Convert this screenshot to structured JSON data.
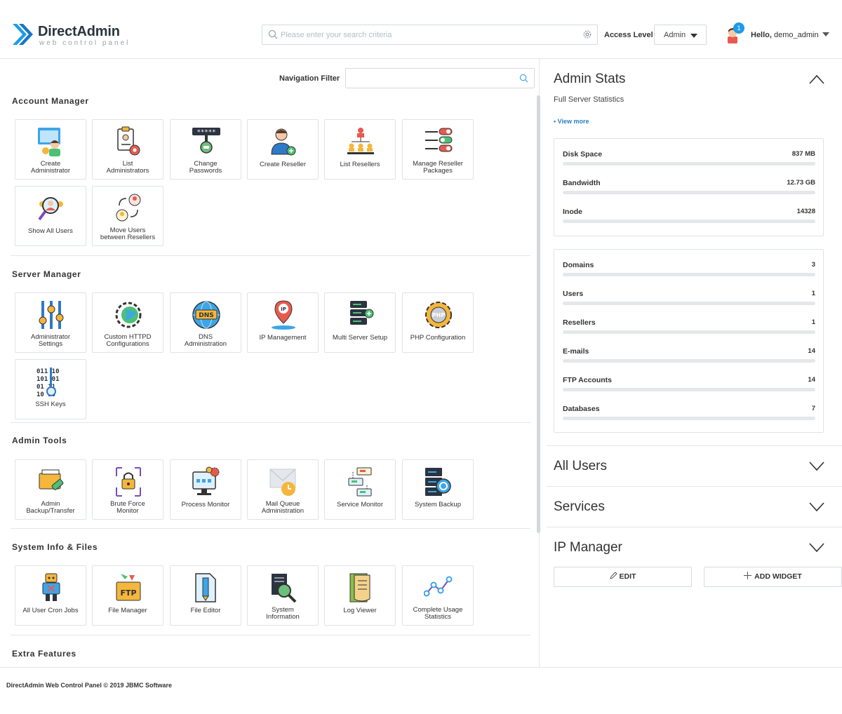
{
  "brand": {
    "name": "DirectAdmin",
    "tagline": "web control panel",
    "accent": "#1e9be8"
  },
  "header": {
    "search_placeholder": "Please enter your search criteria",
    "access_level_label": "Access Level",
    "access_level_value": "Admin",
    "notification_count": "1",
    "hello_prefix": "Hello,",
    "username": "demo_admin"
  },
  "nav_filter": {
    "label": "Navigation Filter",
    "value": ""
  },
  "sections": {
    "account_manager": {
      "title": "Account Manager",
      "items": [
        {
          "label": "Create\nAdministrator",
          "icon": "create-administrator-icon"
        },
        {
          "label": "List\nAdministrators",
          "icon": "list-administrators-icon"
        },
        {
          "label": "Change\nPasswords",
          "icon": "change-passwords-icon"
        },
        {
          "label": "Create Reseller",
          "icon": "create-reseller-icon"
        },
        {
          "label": "List Resellers",
          "icon": "list-resellers-icon"
        },
        {
          "label": "Manage Reseller\nPackages",
          "icon": "manage-reseller-packages-icon"
        },
        {
          "label": "Show All Users",
          "icon": "show-all-users-icon"
        },
        {
          "label": "Move Users\nbetween Resellers",
          "icon": "move-users-icon"
        }
      ]
    },
    "server_manager": {
      "title": "Server Manager",
      "items": [
        {
          "label": "Administrator\nSettings",
          "icon": "admin-settings-icon"
        },
        {
          "label": "Custom HTTPD\nConfigurations",
          "icon": "httpd-config-icon"
        },
        {
          "label": "DNS\nAdministration",
          "icon": "dns-icon"
        },
        {
          "label": "IP Management",
          "icon": "ip-management-icon"
        },
        {
          "label": "Multi Server Setup",
          "icon": "multi-server-icon"
        },
        {
          "label": "PHP Configuration",
          "icon": "php-config-icon"
        },
        {
          "label": "SSH Keys",
          "icon": "ssh-keys-icon"
        }
      ]
    },
    "admin_tools": {
      "title": "Admin Tools",
      "items": [
        {
          "label": "Admin\nBackup/Transfer",
          "icon": "backup-transfer-icon"
        },
        {
          "label": "Brute Force\nMonitor",
          "icon": "brute-force-icon"
        },
        {
          "label": "Process Monitor",
          "icon": "process-monitor-icon"
        },
        {
          "label": "Mail Queue\nAdministration",
          "icon": "mail-queue-icon"
        },
        {
          "label": "Service Monitor",
          "icon": "service-monitor-icon"
        },
        {
          "label": "System Backup",
          "icon": "system-backup-icon"
        }
      ]
    },
    "system_info": {
      "title": "System Info & Files",
      "items": [
        {
          "label": "All User Cron Jobs",
          "icon": "cron-jobs-icon"
        },
        {
          "label": "File Manager",
          "icon": "file-manager-icon"
        },
        {
          "label": "File Editor",
          "icon": "file-editor-icon"
        },
        {
          "label": "System\nInformation",
          "icon": "system-info-icon"
        },
        {
          "label": "Log Viewer",
          "icon": "log-viewer-icon"
        },
        {
          "label": "Complete Usage\nStatistics",
          "icon": "usage-stats-icon"
        }
      ]
    },
    "extra_features": {
      "title": "Extra Features"
    }
  },
  "admin_stats": {
    "title": "Admin Stats",
    "subtitle": "Full Server Statistics",
    "view_more": "• View more",
    "usage": [
      {
        "label": "Disk Space",
        "value": "837 MB"
      },
      {
        "label": "Bandwidth",
        "value": "12.73 GB"
      },
      {
        "label": "Inode",
        "value": "14328"
      }
    ],
    "counts": [
      {
        "label": "Domains",
        "value": "3"
      },
      {
        "label": "Users",
        "value": "1"
      },
      {
        "label": "Resellers",
        "value": "1"
      },
      {
        "label": "E-mails",
        "value": "14"
      },
      {
        "label": "FTP Accounts",
        "value": "14"
      },
      {
        "label": "Databases",
        "value": "7"
      }
    ]
  },
  "widgets": {
    "all_users": "All Users",
    "services": "Services",
    "ip_manager": "IP Manager"
  },
  "buttons": {
    "edit": "EDIT",
    "add_widget": "ADD WIDGET"
  },
  "footer": {
    "text": "DirectAdmin Web Control Panel © 2019 JBMC Software"
  }
}
